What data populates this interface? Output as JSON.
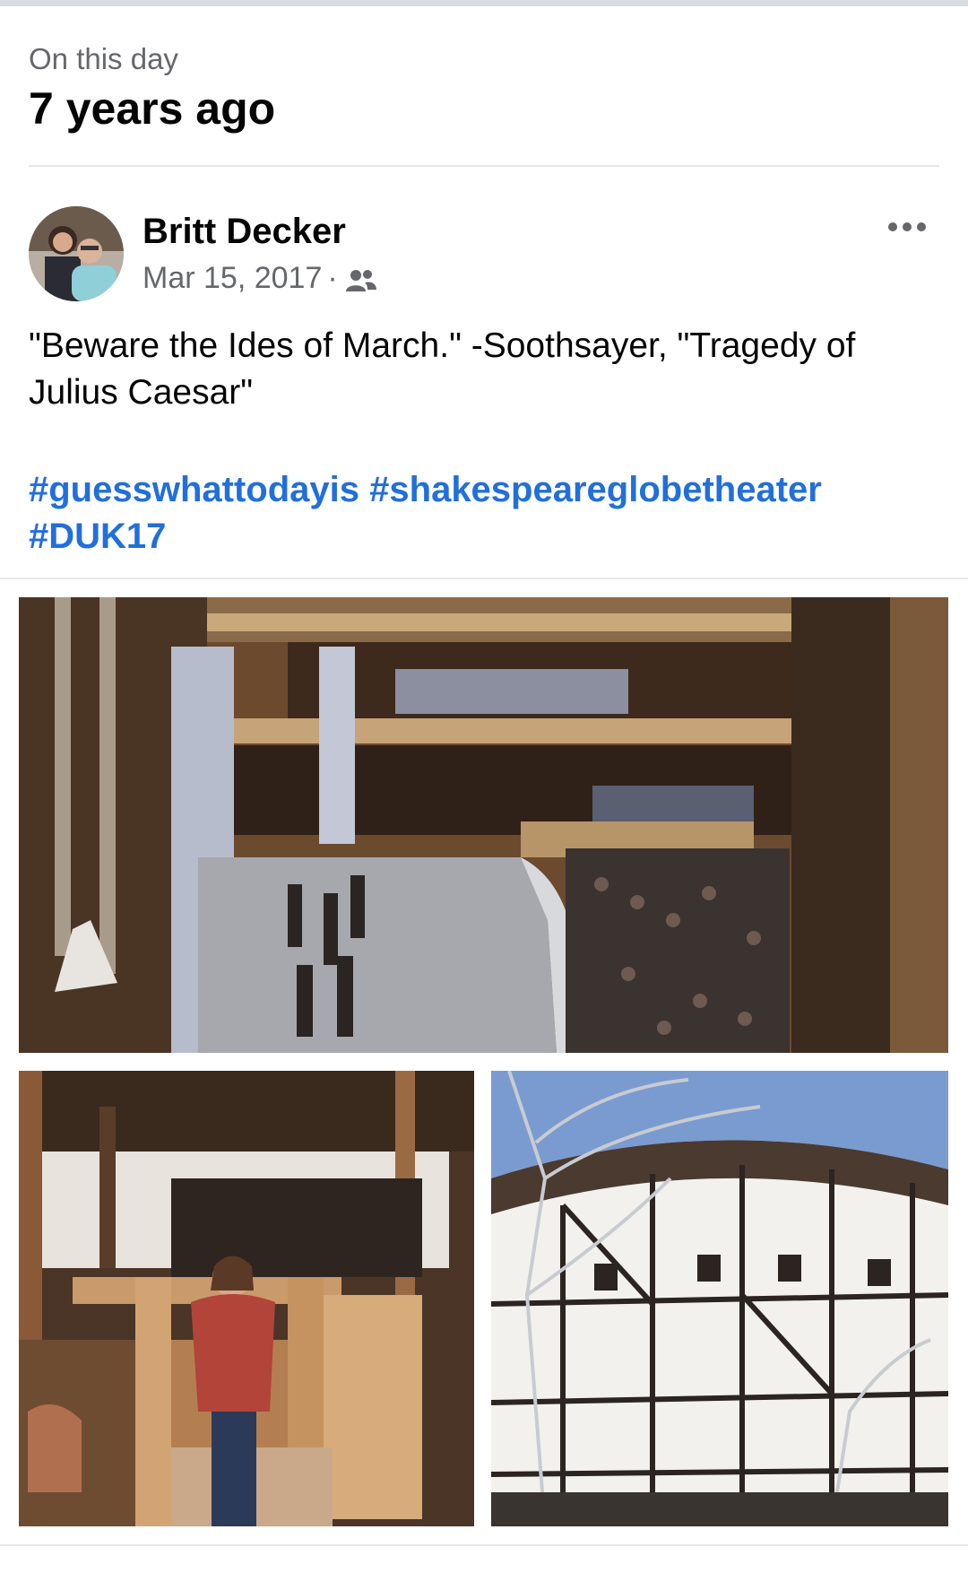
{
  "memory": {
    "label": "On this day",
    "title": "7 years ago"
  },
  "post": {
    "author": "Britt Decker",
    "date": "Mar 15, 2017",
    "separator": "·",
    "audience_icon": "friends-icon",
    "more_icon": "more-horizontal-icon",
    "text": "\"Beware the Ides of March.\" -Soothsayer, \"Tragedy of Julius Caesar\"",
    "hashtags": [
      "#guesswhattodayis",
      "#shakespeareglobetheater",
      "#DUK17"
    ]
  },
  "colors": {
    "hashtag": "#216fdb",
    "secondary_text": "#65676b",
    "primary_text": "#050505",
    "divider": "#e4e6eb"
  }
}
